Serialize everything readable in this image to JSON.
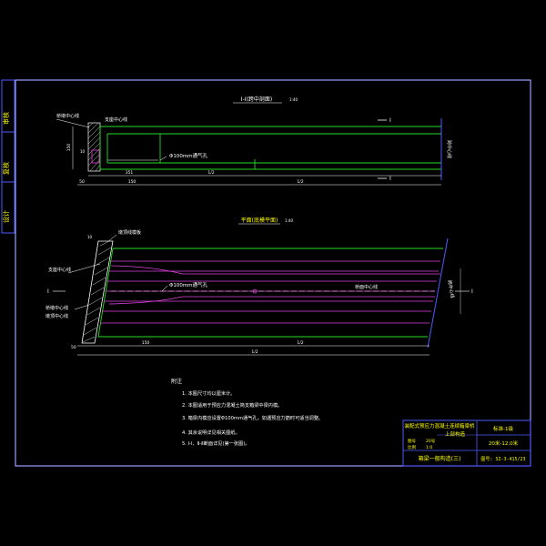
{
  "side_tabs": [
    "审核",
    "复核",
    "设计"
  ],
  "section_view": {
    "title": "Ⅰ-Ⅰ(跨中剖面)",
    "scale": "1:40",
    "section_mark_top": "Ⅰ",
    "section_mark_bottom": "Ⅰ",
    "label_bearing_line": "桥墩中心线",
    "label_support_center": "支座中心线",
    "label_vent": "Φ100mm通气孔",
    "label_right_vertical": "跨中心线",
    "dim_left_height": "150",
    "dim_left_small": "10",
    "dim_a": "351",
    "dim_b": "1/2",
    "dim_bottom_small": "50",
    "dim_bottom_a": "150",
    "dim_bottom_b": "1/2"
  },
  "plan_view": {
    "title": "平面(底模平面)",
    "scale": "1:40",
    "label_top_right": "墩顶线模板",
    "label_left_top": "支座中心线",
    "label_left_mid": "Ⅰ",
    "label_left_bottom_1": "桥墩中心线",
    "label_left_bottom_2": "墩顶中心线",
    "label_vent": "Φ100mm通气孔",
    "label_center_mark": "桥面中心线",
    "label_right_mark": "Ⅰ",
    "label_right_vertical": "跨中心线",
    "dim_top_small": "10",
    "dim_bottom_small": "50",
    "dim_bottom_a": "150",
    "dim_bottom_b": "1/2",
    "dim_total": "1/2"
  },
  "notes": {
    "heading": "附注",
    "items": [
      "1. 本图尺寸均以厘米计。",
      "2. 本图适用于预应力混凝土简支箱梁中梁内模。",
      "3. 箱梁内模应设置Φ100mm通气孔，如遇预应力筋时可适当调整。",
      "4. 其余说明详见相关图纸。",
      "5. Ⅰ-Ⅰ、Ⅱ-Ⅱ断面详见(第一张图)。"
    ]
  },
  "title_block": {
    "project": "装配式预应力混凝土连续箱梁桥",
    "subtitle": "上部构造",
    "drawing_no_label": "图号",
    "drawing_no": "20号",
    "scale_label": "比例",
    "scale": "1:0",
    "series": "标准-1级",
    "span": "20米-12.0米",
    "drawing_title": "箱梁一般构造(三)",
    "sheet": "图号: SI-3-415/23"
  },
  "colors": {
    "frame": "#4e5bff",
    "outline": "#ffffff",
    "green": "#22dd22",
    "magenta": "#e040e0",
    "yellow": "#ffff00",
    "cyan": "#00ffff",
    "title_text": "#ffff00"
  }
}
